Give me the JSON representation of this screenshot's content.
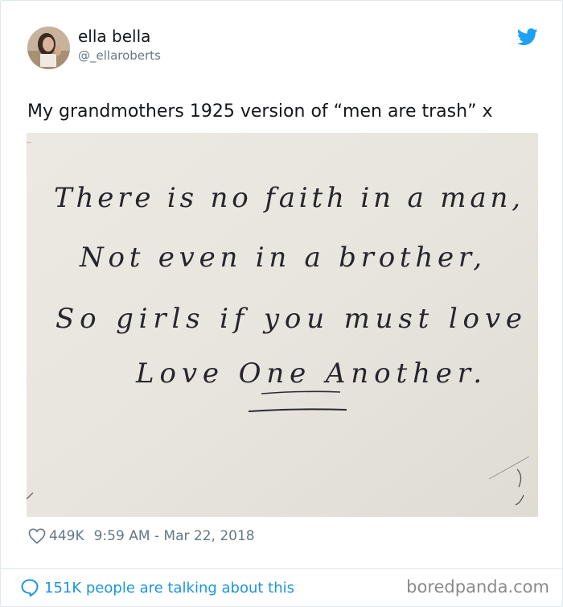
{
  "tweet": {
    "display_name": "ella bella",
    "handle": "@_ellaroberts",
    "text": "My grandmothers 1925 version of “men are trash” x",
    "photo": {
      "handwriting_lines": [
        "There is no faith in a man,",
        "Not even in a brother,",
        "So girls if you must love",
        "Love One Another."
      ]
    },
    "likes": "449K",
    "timestamp": "9:59 AM - Mar 22, 2018"
  },
  "footer": {
    "talking_text": "151K people are talking about this",
    "watermark": "boredpanda.com"
  },
  "icons": {
    "heart": "heart-icon",
    "bird": "twitter-bird-icon",
    "bubble": "speech-bubble-icon"
  },
  "colors": {
    "twitter_blue": "#1da1f2",
    "link_blue": "#1b95e0",
    "muted": "#657786",
    "paper": "#e9e6df"
  }
}
